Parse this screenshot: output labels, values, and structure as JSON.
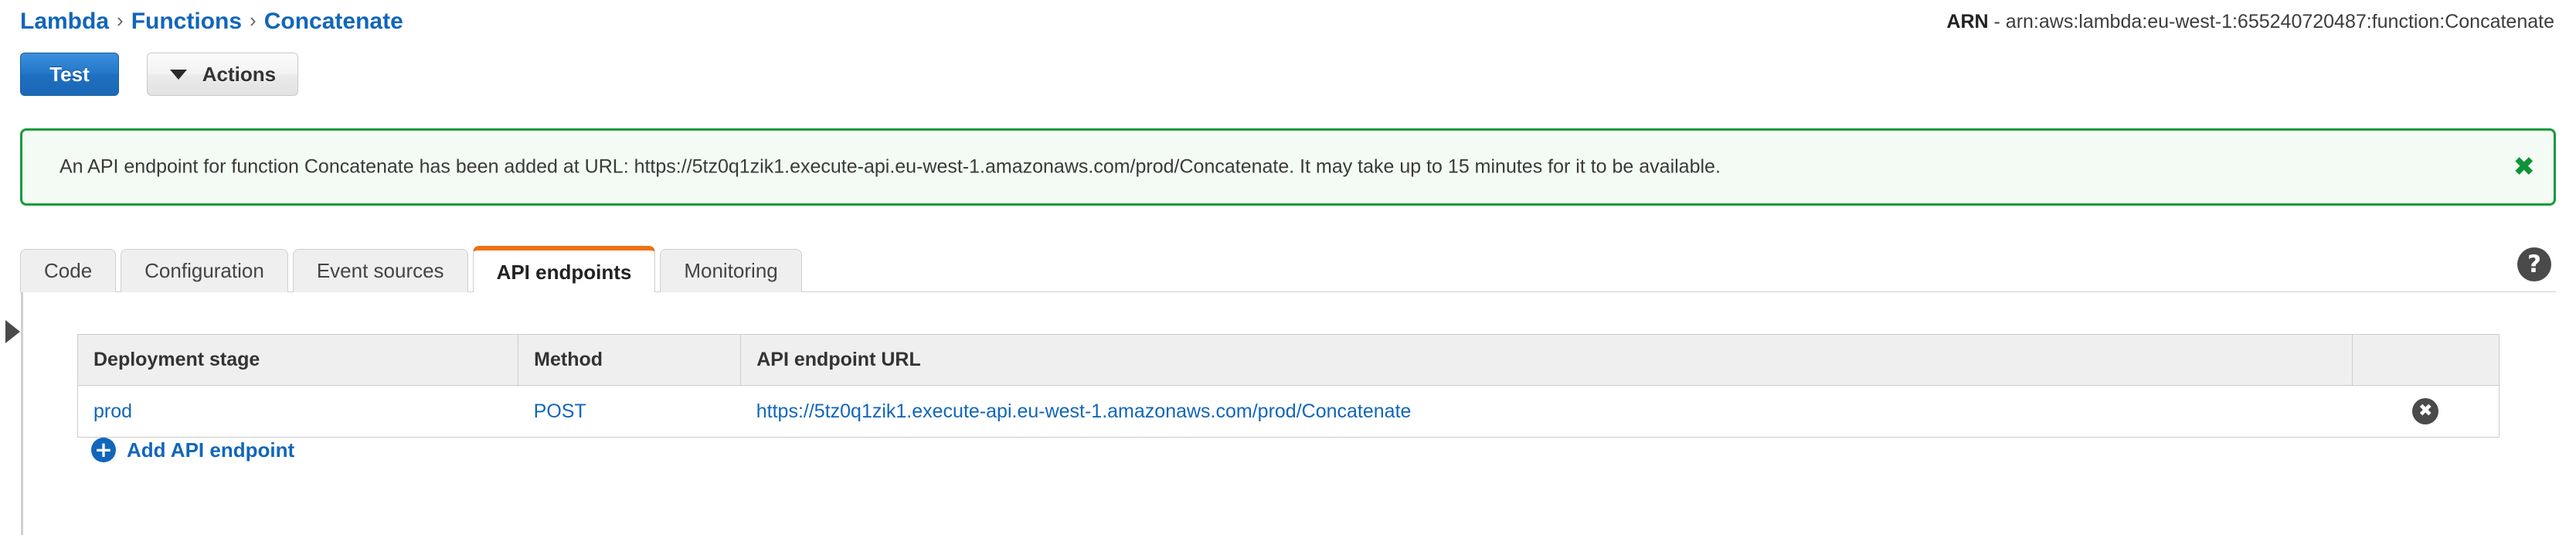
{
  "breadcrumb": {
    "items": [
      {
        "label": "Lambda"
      },
      {
        "label": "Functions"
      },
      {
        "label": "Concatenate"
      }
    ],
    "separator": "›"
  },
  "arn": {
    "label": "ARN",
    "value": "- arn:aws:lambda:eu-west-1:655240720487:function:Concatenate"
  },
  "toolbar": {
    "test_label": "Test",
    "actions_label": "Actions",
    "caret_icon": "chevron-down-icon"
  },
  "alert": {
    "message": "An API endpoint for function Concatenate has been added at URL: https://5tz0q1zik1.execute-api.eu-west-1.amazonaws.com/prod/Concatenate. It may take up to 15 minutes for it to be available.",
    "close_glyph": "✖",
    "border_color": "#169b3c",
    "background_color": "#f4fbf4"
  },
  "tabs": {
    "items": [
      {
        "label": "Code",
        "active": false
      },
      {
        "label": "Configuration",
        "active": false
      },
      {
        "label": "Event sources",
        "active": false
      },
      {
        "label": "API endpoints",
        "active": true
      },
      {
        "label": "Monitoring",
        "active": false
      }
    ],
    "active_accent_color": "#ec7211",
    "help_glyph": "?"
  },
  "sidebar": {
    "expand_icon": "triangle-right-icon"
  },
  "table": {
    "columns": [
      "Deployment stage",
      "Method",
      "API endpoint URL",
      ""
    ],
    "rows": [
      {
        "stage": "prod",
        "method": "POST",
        "url": "https://5tz0q1zik1.execute-api.eu-west-1.amazonaws.com/prod/Concatenate",
        "delete_glyph": "✖"
      }
    ]
  },
  "actions": {
    "add_endpoint_label": "Add API endpoint",
    "add_endpoint_glyph": "+"
  }
}
